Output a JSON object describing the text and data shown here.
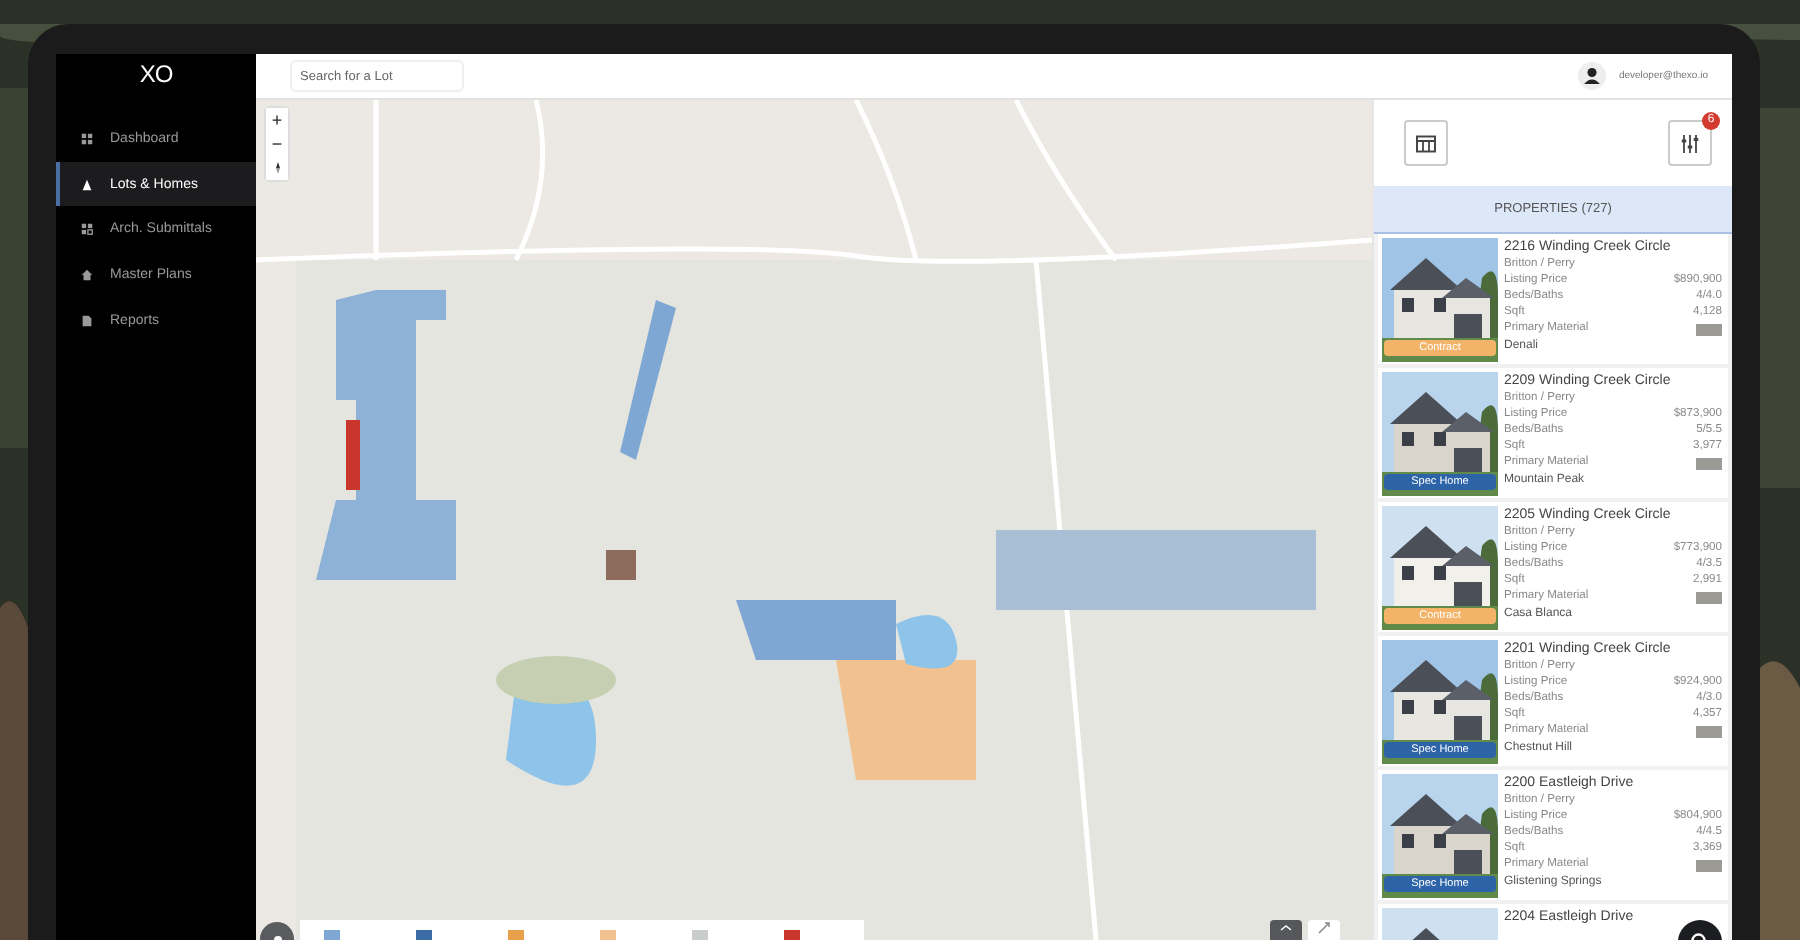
{
  "sidebar": {
    "logo": "XO",
    "items": [
      {
        "label": "Dashboard",
        "selected": false
      },
      {
        "label": "Lots & Homes",
        "selected": true
      },
      {
        "label": "Arch. Submittals",
        "selected": false
      },
      {
        "label": "Master Plans",
        "selected": false
      },
      {
        "label": "Reports",
        "selected": false
      }
    ]
  },
  "topbar": {
    "search": {
      "placeholder": "Search for a Lot"
    },
    "user": "developer@thexo.io"
  },
  "map": {
    "zoom_in": "+",
    "zoom_out": "−",
    "legend": [
      {
        "color": "#7fa7d3"
      },
      {
        "color": "#3c6ca6"
      },
      {
        "color": "#e9a04a"
      },
      {
        "color": "#f1c28f"
      },
      {
        "color": "#c9cccd"
      },
      {
        "color": "#c9372c"
      }
    ]
  },
  "properties": {
    "filter_count": "6",
    "title": "PROPERTIES (727)",
    "cards": [
      {
        "title": "2216 Winding Creek Circle",
        "builder": "Britton / Perry",
        "badge": {
          "label": "Contract",
          "kind": "contract"
        },
        "rows": [
          {
            "label": "Listing Price",
            "value": "$890,900"
          },
          {
            "label": "Beds/Baths",
            "value": "4/4.0"
          },
          {
            "label": "Sqft",
            "value": "4,128"
          }
        ],
        "material_label": "Primary Material",
        "material": "Denali"
      },
      {
        "title": "2209 Winding Creek Circle",
        "builder": "Britton / Perry",
        "badge": {
          "label": "Spec Home",
          "kind": "spec"
        },
        "rows": [
          {
            "label": "Listing Price",
            "value": "$873,900"
          },
          {
            "label": "Beds/Baths",
            "value": "5/5.5"
          },
          {
            "label": "Sqft",
            "value": "3,977"
          }
        ],
        "material_label": "Primary Material",
        "material": "Mountain Peak"
      },
      {
        "title": "2205 Winding Creek Circle",
        "builder": "Britton / Perry",
        "badge": {
          "label": "Contract",
          "kind": "contract"
        },
        "rows": [
          {
            "label": "Listing Price",
            "value": "$773,900"
          },
          {
            "label": "Beds/Baths",
            "value": "4/3.5"
          },
          {
            "label": "Sqft",
            "value": "2,991"
          }
        ],
        "material_label": "Primary Material",
        "material": "Casa Blanca"
      },
      {
        "title": "2201 Winding Creek Circle",
        "builder": "Britton / Perry",
        "badge": {
          "label": "Spec Home",
          "kind": "spec"
        },
        "rows": [
          {
            "label": "Listing Price",
            "value": "$924,900"
          },
          {
            "label": "Beds/Baths",
            "value": "4/3.0"
          },
          {
            "label": "Sqft",
            "value": "4,357"
          }
        ],
        "material_label": "Primary Material",
        "material": "Chestnut Hill"
      },
      {
        "title": "2200 Eastleigh Drive",
        "builder": "Britton / Perry",
        "badge": {
          "label": "Spec Home",
          "kind": "spec"
        },
        "rows": [
          {
            "label": "Listing Price",
            "value": "$804,900"
          },
          {
            "label": "Beds/Baths",
            "value": "4/4.5"
          },
          {
            "label": "Sqft",
            "value": "3,369"
          }
        ],
        "material_label": "Primary Material",
        "material": "Glistening Springs"
      },
      {
        "title": "2204 Eastleigh Drive"
      }
    ]
  }
}
